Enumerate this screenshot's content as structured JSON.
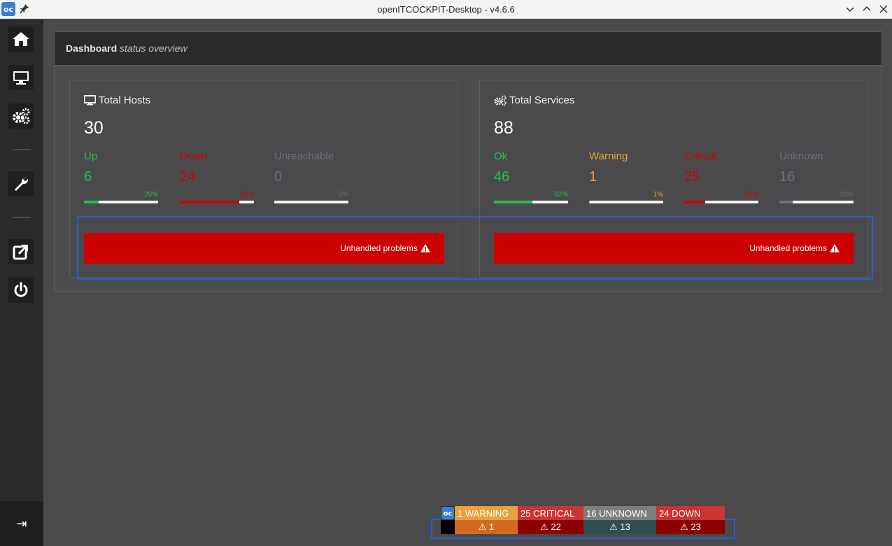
{
  "window": {
    "title": "openITCOCKPIT-Desktop - v4.6.6"
  },
  "sidebar": {
    "items": [
      {
        "icon": "home-icon"
      },
      {
        "icon": "monitor-icon"
      },
      {
        "icon": "gears-icon"
      },
      {
        "icon": "wrench-icon"
      },
      {
        "icon": "external-link-icon"
      },
      {
        "icon": "power-icon"
      }
    ],
    "collapse_glyph": "⇥"
  },
  "header": {
    "title": "Dashboard",
    "subtitle": "status overview"
  },
  "hosts": {
    "title": "Total Hosts",
    "total": "30",
    "stats": [
      {
        "label": "Up",
        "value": "6",
        "pct_label": "20%",
        "percent": 20,
        "color": "#1fc24b"
      },
      {
        "label": "Down",
        "value": "24",
        "pct_label": "80%",
        "percent": 80,
        "color": "#cc0000"
      },
      {
        "label": "Unreachable",
        "value": "0",
        "pct_label": "0%",
        "percent": 0,
        "color": "#6f7177"
      }
    ],
    "problems_label": "Unhandled problems"
  },
  "services": {
    "title": "Total Services",
    "total": "88",
    "stats": [
      {
        "label": "Ok",
        "value": "46",
        "pct_label": "52%",
        "percent": 52,
        "color": "#1fc24b"
      },
      {
        "label": "Warning",
        "value": "1",
        "pct_label": "1%",
        "percent": 1,
        "color": "#f0a22e"
      },
      {
        "label": "Critical",
        "value": "25",
        "pct_label": "28%",
        "percent": 28,
        "color": "#cc0000"
      },
      {
        "label": "Unknown",
        "value": "16",
        "pct_label": "18%",
        "percent": 18,
        "color": "#6f7177"
      }
    ],
    "problems_label": "Unhandled problems"
  },
  "widget": {
    "top": [
      {
        "text": "1 WARNING",
        "color": "#e7a13f"
      },
      {
        "text": "25 CRITICAL",
        "color": "#cc3333"
      },
      {
        "text": "16 UNKNOWN",
        "color": "#7e7e7e"
      },
      {
        "text": "24 DOWN",
        "color": "#cc3333"
      }
    ],
    "bottom": [
      {
        "text": "⚠ 1",
        "color": "#d2691e"
      },
      {
        "text": "⚠ 22",
        "color": "#8b0000"
      },
      {
        "text": "⚠ 13",
        "color": "#2f4f4f"
      },
      {
        "text": "⚠ 23",
        "color": "#8b0000"
      }
    ]
  }
}
